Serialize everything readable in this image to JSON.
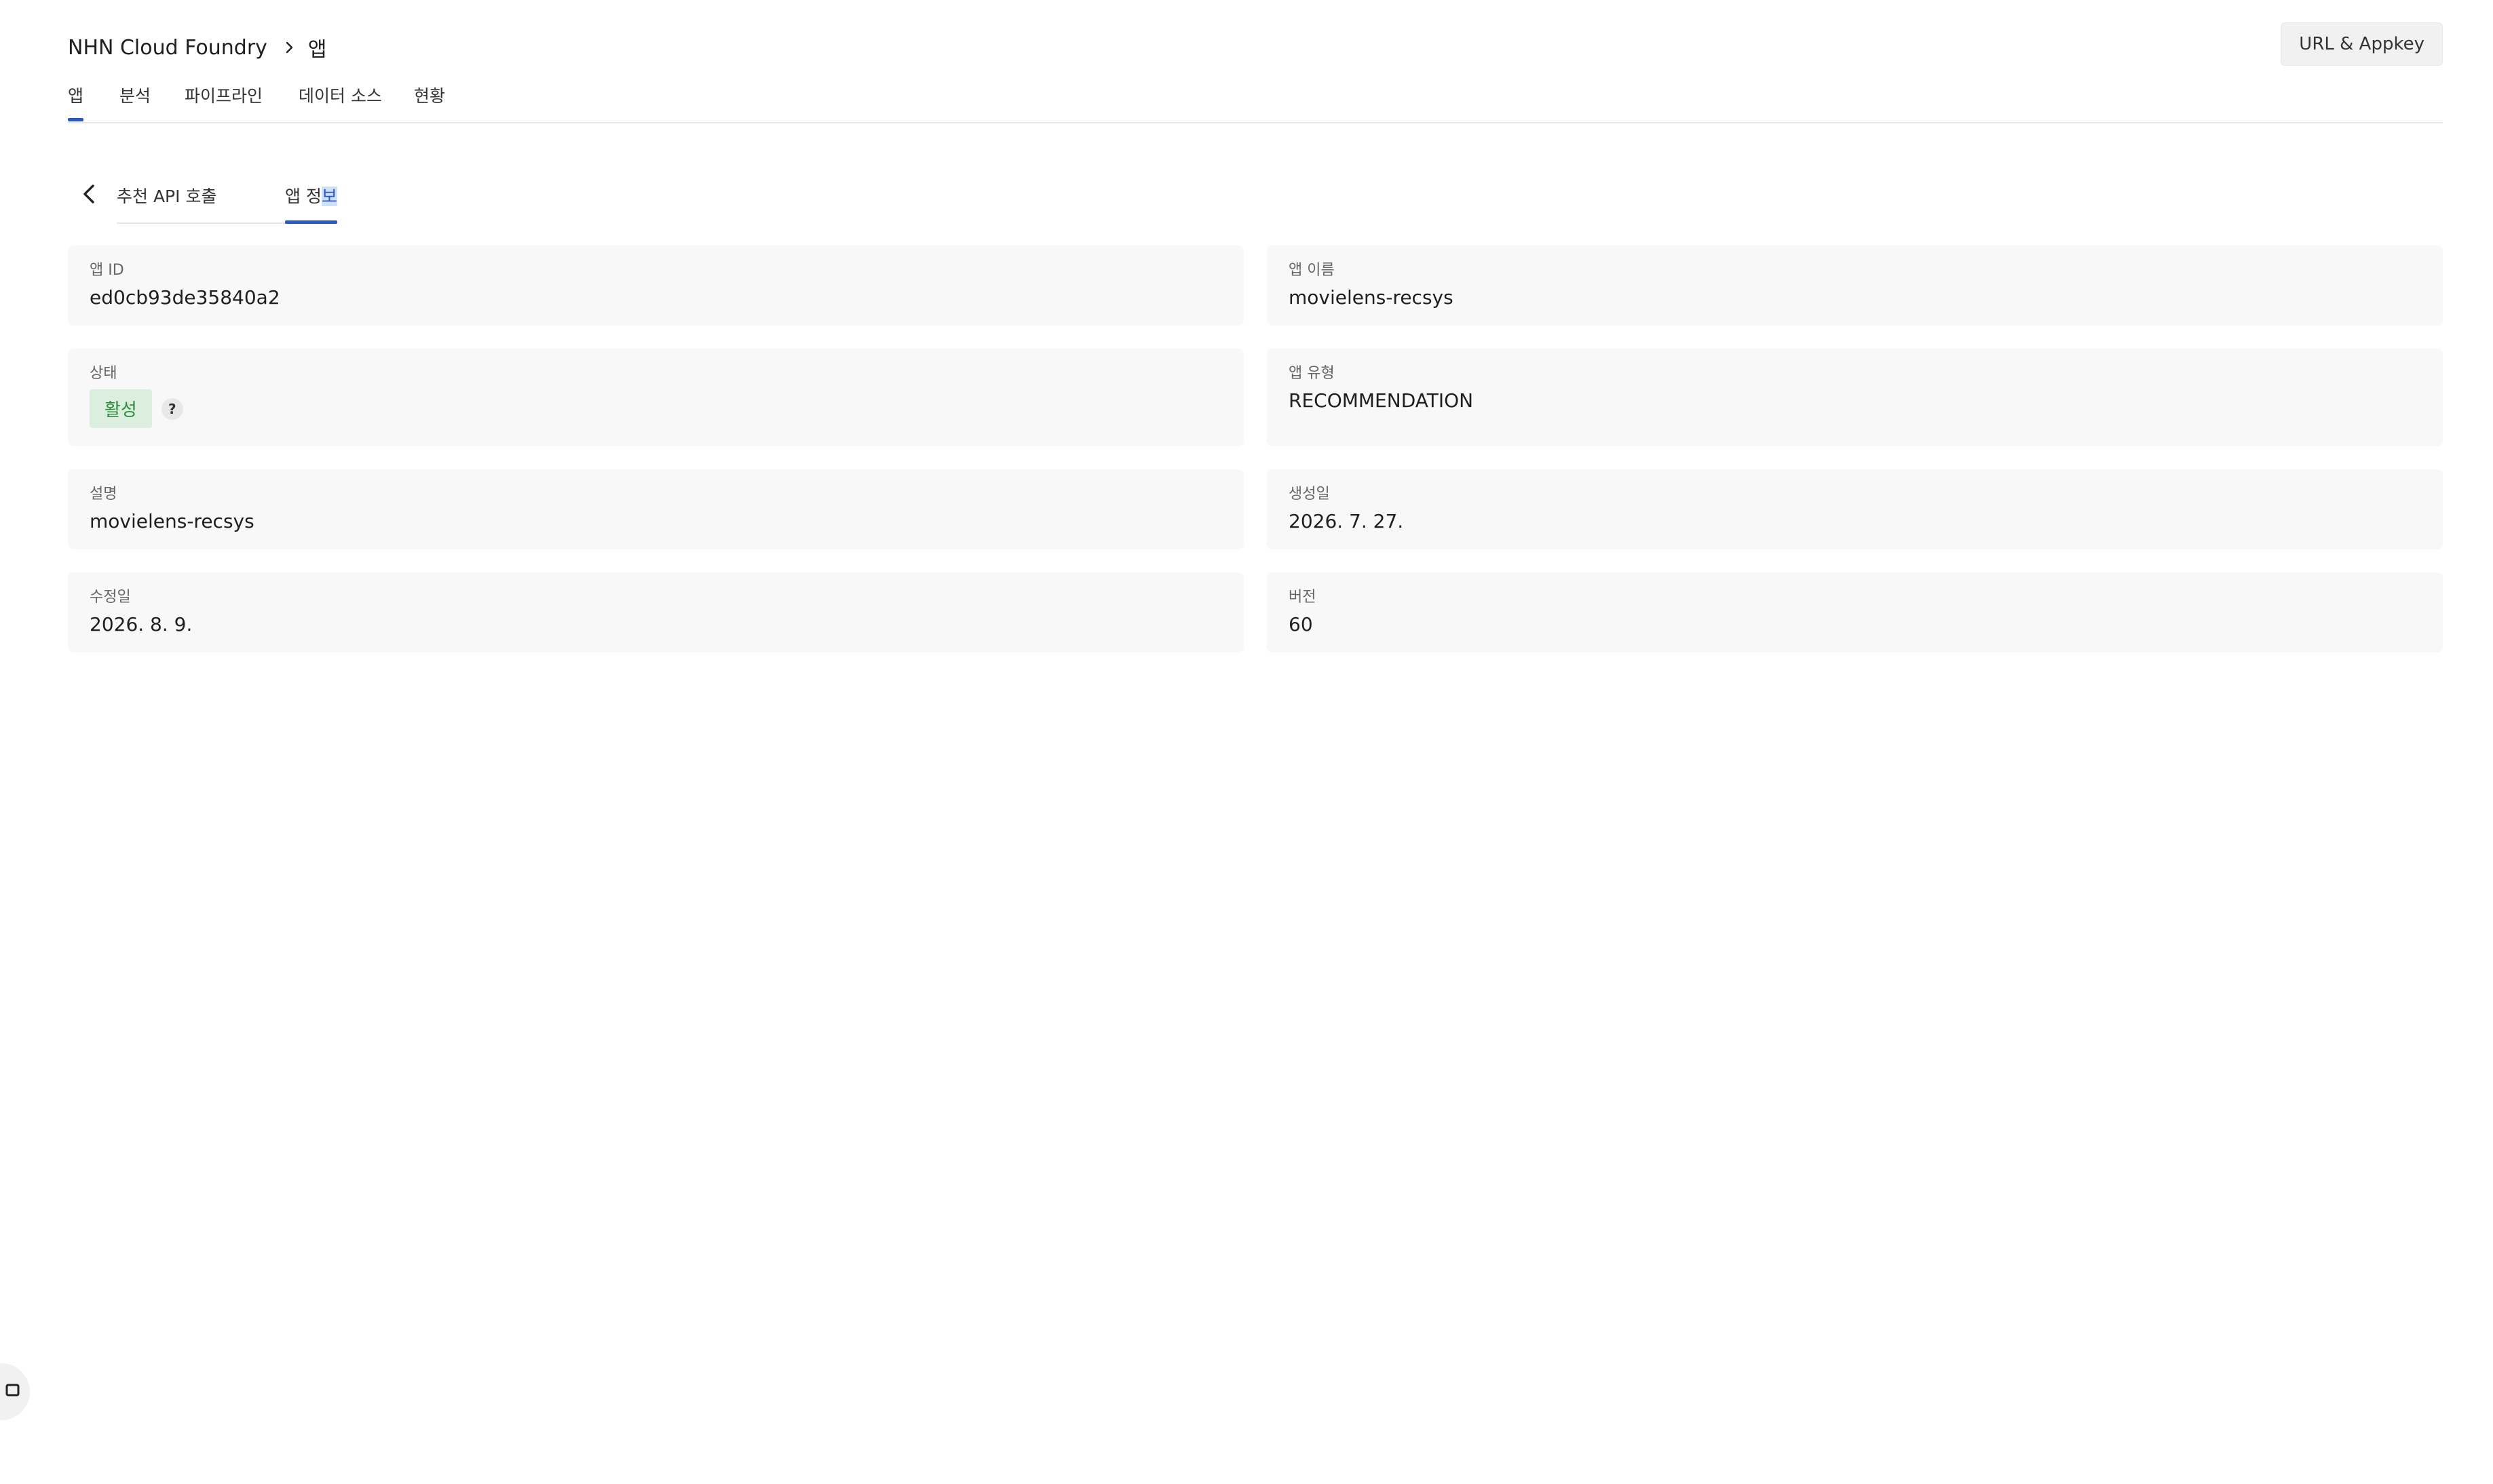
{
  "header": {
    "breadcrumb": [
      "NHN Cloud Foundry",
      "앱"
    ],
    "appkey_button": "URL & Appkey"
  },
  "main_tabs": [
    {
      "label": "앱",
      "active": true
    },
    {
      "label": "분석",
      "active": false
    },
    {
      "label": "파이프라인",
      "active": false
    },
    {
      "label": "데이터 소스",
      "active": false
    },
    {
      "label": "현황",
      "active": false
    }
  ],
  "sub_tabs": {
    "back_icon": "chevron-left-icon",
    "items": [
      {
        "label": "추천 API 호출",
        "active": false
      },
      {
        "label_a": "앱 정",
        "label_b": "보",
        "active": true
      }
    ]
  },
  "fields": {
    "app_id": {
      "label": "앱 ID",
      "value": "ed0cb93de35840a2"
    },
    "app_name": {
      "label": "앱 이름",
      "value": "movielens-recsys"
    },
    "status": {
      "label": "상태",
      "value": "활성",
      "help": "?"
    },
    "app_type": {
      "label": "앱 유형",
      "value": "RECOMMENDATION"
    },
    "description": {
      "label": "설명",
      "value": "movielens-recsys"
    },
    "created": {
      "label": "생성일",
      "value": "2026. 7. 27."
    },
    "modified": {
      "label": "수정일",
      "value": "2026. 8. 9."
    },
    "version": {
      "label": "버전",
      "value": "60"
    }
  },
  "colors": {
    "accent": "#2b59c3",
    "status_bg": "#dcefdf",
    "status_text": "#2e8b3e",
    "card_bg": "#f8f8f8"
  }
}
